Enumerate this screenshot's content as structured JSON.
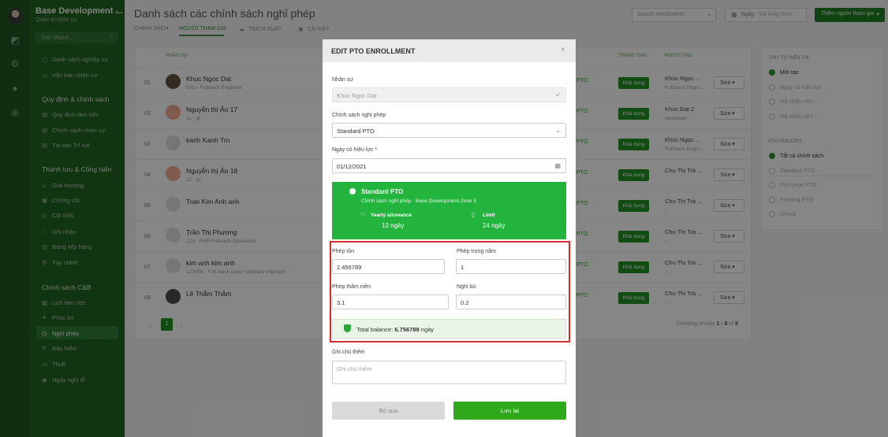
{
  "sidebar": {
    "title": "Base Development ...",
    "subtitle": "Quản trị nhân sự",
    "search_placeholder": "Tìm nhanh...",
    "items_top": [
      {
        "label": "Danh sách nghiệp vụ",
        "icon": "grid-icon"
      },
      {
        "label": "Văn bản nhân sự",
        "icon": "folder-icon"
      }
    ],
    "section_rules": "Quy định & chính sách",
    "rules_items": [
      {
        "label": "Quy định làm việc",
        "icon": "doc-icon"
      },
      {
        "label": "Chính sách nhân sự",
        "icon": "doc-icon"
      },
      {
        "label": "Tài sản Trí tuệ",
        "icon": "doc-icon"
      }
    ],
    "section_achievements": "Thành tựu & Cống hiến",
    "achievement_items": [
      {
        "label": "Giải thưởng",
        "icon": "trophy-icon"
      },
      {
        "label": "Chứng chỉ",
        "icon": "certificate-icon"
      },
      {
        "label": "Cột mốc",
        "icon": "milestone-icon"
      },
      {
        "label": "Ghi nhận",
        "icon": "heart-icon"
      },
      {
        "label": "Bảng xếp hạng",
        "icon": "ranking-icon"
      },
      {
        "label": "Tùy chỉnh",
        "icon": "settings-icon"
      }
    ],
    "section_cb": "Chính sách C&B",
    "cb_items": [
      {
        "label": "Lịch làm việc",
        "icon": "calendar-icon"
      },
      {
        "label": "Phúc lợi",
        "icon": "gift-icon"
      },
      {
        "label": "Nghỉ phép",
        "icon": "clock-icon",
        "active": true
      },
      {
        "label": "Bảo hiểm",
        "icon": "shield-icon"
      },
      {
        "label": "Thuế",
        "icon": "tax-icon"
      },
      {
        "label": "Ngày nghỉ lễ",
        "icon": "check-circle-icon"
      }
    ]
  },
  "header": {
    "title": "Danh sách các chính sách nghỉ phép",
    "tabs": [
      {
        "label": "CHÍNH SÁCH"
      },
      {
        "label": "NGƯỜI THAM GIA",
        "active": true
      },
      {
        "label": "TRÍCH XUẤT"
      },
      {
        "label": "CÀI ĐẶT"
      }
    ],
    "search_placeholder": "Search enrollments",
    "date_label": "Ngày:",
    "date_placeholder": "Vui lòng chọn",
    "add_button": "Thêm người tham gia"
  },
  "table": {
    "columns": {
      "name": "NHÂN SỰ",
      "status": "TRẠNG THÁI",
      "creator": "NGƯỜI TẠO"
    },
    "rows": [
      {
        "num": "01",
        "name": "Khuc Ngoc Dat",
        "sub": "D01 · Fullstack Engineer",
        "status": "PTO",
        "badge": "Khả dụng",
        "creator": "Khúc Ngọc ...",
        "creator_sub": "Fullstack Engin...",
        "edit": "Sửa",
        "avatar_color": "#5b5040"
      },
      {
        "num": "02",
        "name": "Nguyễn thị Ảo 17",
        "sub": "11 · gì",
        "status": "PTO",
        "badge": "Khả dụng",
        "creator": "Khúc Đạt 2",
        "creator_sub": "developer",
        "edit": "Sửa",
        "avatar_color": "#e8a58c"
      },
      {
        "num": "03",
        "name": "kanh Kanh Trn",
        "sub": "",
        "status": "PTO",
        "badge": "Khả dụng",
        "creator": "Khúc Ngọc ...",
        "creator_sub": "Fullstack Engin...",
        "edit": "Sửa",
        "avatar_color": "#d8d8d8"
      },
      {
        "num": "04",
        "name": "Nguyễn thị Ảo 18",
        "sub": "12 · gì",
        "status": "PTO",
        "badge": "Khả dụng",
        "creator": "Chu Thị Trà ...",
        "creator_sub": "",
        "edit": "Sửa",
        "avatar_color": "#e8a58c"
      },
      {
        "num": "05",
        "name": "Tran Kim Anh anh",
        "sub": "",
        "status": "PTO",
        "badge": "Khả dụng",
        "creator": "Chu Thị Trà ...",
        "creator_sub": "--",
        "edit": "Sửa",
        "avatar_color": "#d8d8d8"
      },
      {
        "num": "06",
        "name": "Trần Thị Phương",
        "sub": "123 · PHP Fullstack Developer",
        "status": "PTO",
        "badge": "Khả dụng",
        "creator": "Chu Thị Trà ...",
        "creator_sub": "--",
        "edit": "Sửa",
        "avatar_color": "#d8d8d8"
      },
      {
        "num": "07",
        "name": "kim anh kim anh",
        "sub": "123456 · Full stack junior software engineer",
        "status": "PTO",
        "badge": "Khả dụng",
        "creator": "Chu Thị Trà ...",
        "creator_sub": "--",
        "edit": "Sửa",
        "avatar_color": "#d8d8d8"
      },
      {
        "num": "08",
        "name": "Lê Thắm Thắm",
        "sub": "",
        "status": "PTO",
        "badge": "Khả dụng",
        "creator": "Chu Thị Trà ...",
        "creator_sub": "--",
        "edit": "Sửa",
        "avatar_color": "#4a4a4a"
      }
    ],
    "current_page": "1",
    "showing_prefix": "Showing results",
    "showing_range": "1 - 8",
    "showing_of": "of",
    "showing_total": "8"
  },
  "filters": {
    "sort_heading": "THỨ TỰ HIỂN THỊ",
    "sort_options": [
      {
        "label": "Mới tạo",
        "selected": true
      },
      {
        "label": "Ngày có hiệu lực",
        "selected": false
      },
      {
        "label": "Mã nhân viên ↑",
        "selected": false
      },
      {
        "label": "Mã nhân viên ↓",
        "selected": false
      }
    ],
    "policy_heading": "PTO POLICIES",
    "policy_options": [
      {
        "label": "Tất cả chính sách",
        "selected": true
      },
      {
        "label": "Standard PTO",
        "selected": false
      },
      {
        "label": "First-year PTO",
        "selected": false
      },
      {
        "label": "Pending PTO",
        "selected": false
      },
      {
        "label": "Check",
        "selected": false
      }
    ]
  },
  "modal": {
    "title": "EDIT PTO ENROLLMENT",
    "employee_label": "Nhân sự",
    "employee_value": "Khuc Ngoc Dat",
    "policy_label": "Chính sách nghỉ phép",
    "policy_value": "Standard PTO",
    "effective_label": "Ngày có hiệu lực *",
    "effective_value": "01/12/2021",
    "card": {
      "title": "Standard PTO",
      "subtitle": "Chính sách nghỉ phép · Base Development Zone 5",
      "yearly_label": "Yearly allowance",
      "yearly_value": "12 ngày",
      "limit_label": "Limit",
      "limit_value": "24 ngày"
    },
    "remaining_label": "Phép tồn",
    "remaining_value": "2.456789",
    "in_year_label": "Phép trong năm",
    "in_year_value": "1",
    "seniority_label": "Phép thâm niên",
    "seniority_value": "3.1",
    "comp_label": "Nghỉ bù",
    "comp_value": "0.2",
    "balance_prefix": "Total balance:",
    "balance_value": "6.756789",
    "balance_unit": "ngày",
    "note_label": "Ghi chú thêm",
    "note_placeholder": "Ghi chú thêm",
    "cancel": "Bỏ qua",
    "save": "Lưu lại"
  },
  "colors": {
    "brand_green": "#1f8c22",
    "sidebar": "#20601f",
    "highlight_red": "#d32f2f"
  }
}
